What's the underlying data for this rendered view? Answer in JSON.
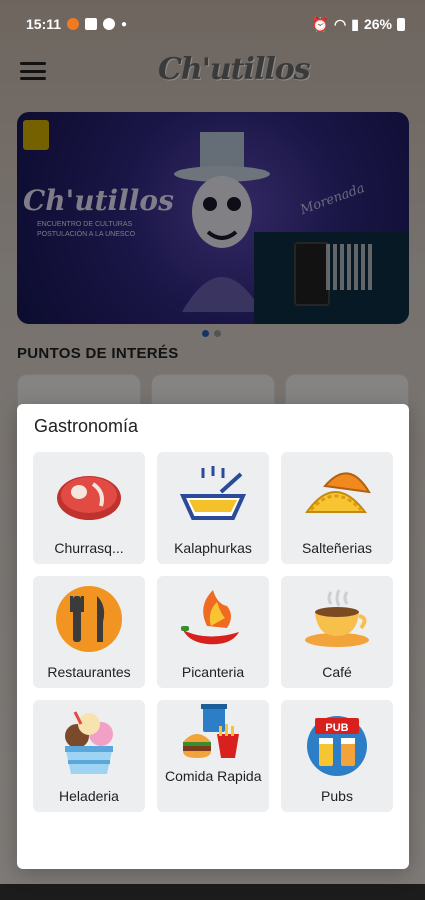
{
  "status_bar": {
    "time": "15:11",
    "battery": "26%"
  },
  "app": {
    "logo": "Ch'utillos",
    "banner": {
      "title": "Ch'utillos",
      "subtitle_line1": "ENCUENTRO DE CULTURAS",
      "subtitle_line2": "POSTULACIÓN A LA UNESCO",
      "signature": "Morenada"
    },
    "section_title": "PUNTOS DE INTERÉS"
  },
  "dialog": {
    "title": "Gastronomía",
    "items": [
      {
        "label": "Churrasq...",
        "icon": "steak-icon"
      },
      {
        "label": "Kalaphurkas",
        "icon": "soup-bowl-icon"
      },
      {
        "label": "Salteñerias",
        "icon": "empanada-icon"
      },
      {
        "label": "Restaurantes",
        "icon": "fork-knife-icon"
      },
      {
        "label": "Picanteria",
        "icon": "hot-pepper-icon"
      },
      {
        "label": "Café",
        "icon": "coffee-cup-icon"
      },
      {
        "label": "Heladeria",
        "icon": "ice-cream-icon"
      },
      {
        "label": "Comida Rapida",
        "icon": "fast-food-icon"
      },
      {
        "label": "Pubs",
        "icon": "pub-icon"
      }
    ]
  },
  "colors": {
    "accent": "#2d5fb4",
    "tile_bg": "#eceef0"
  }
}
